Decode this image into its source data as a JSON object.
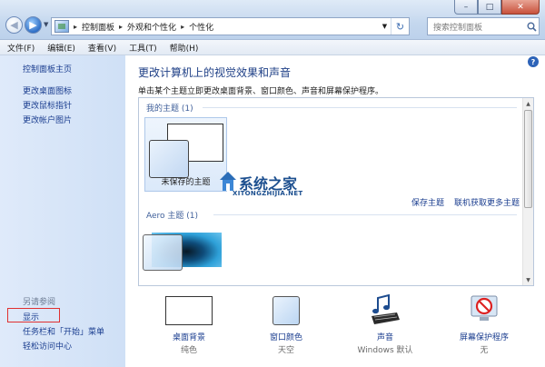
{
  "window": {
    "controls": {
      "minimize": "–",
      "maximize": "□",
      "close": "✕"
    }
  },
  "address": {
    "crumbs": [
      "控制面板",
      "外观和个性化",
      "个性化"
    ],
    "separator": "▸"
  },
  "search": {
    "placeholder": "搜索控制面板"
  },
  "menu": [
    "文件(F)",
    "编辑(E)",
    "查看(V)",
    "工具(T)",
    "帮助(H)"
  ],
  "sidebar": {
    "home": "控制面板主页",
    "links": [
      "更改桌面图标",
      "更改鼠标指针",
      "更改帐户图片"
    ],
    "see_also": "另请参阅",
    "see_also_links": [
      "显示",
      "任务栏和「开始」菜单",
      "轻松访问中心"
    ]
  },
  "main": {
    "title": "更改计算机上的视觉效果和声音",
    "description": "单击某个主题立即更改桌面背景、窗口颜色、声音和屏幕保护程序。",
    "my_themes_header": "我的主题 (1)",
    "unsaved_theme": "未保存的主题",
    "save_theme": "保存主题",
    "get_more_themes": "联机获取更多主题",
    "aero_header": "Aero 主题 (1)"
  },
  "watermark": {
    "cn": "系统之家",
    "en": "XITONGZHIJIA.NET"
  },
  "bottom": [
    {
      "label": "桌面背景",
      "sub": "纯色"
    },
    {
      "label": "窗口颜色",
      "sub": "天空"
    },
    {
      "label": "声音",
      "sub": "Windows 默认"
    },
    {
      "label": "屏幕保护程序",
      "sub": "无"
    }
  ],
  "colors": {
    "link": "#1a3d8f",
    "title": "#1e3f86",
    "highlight_box": "#e03030"
  }
}
